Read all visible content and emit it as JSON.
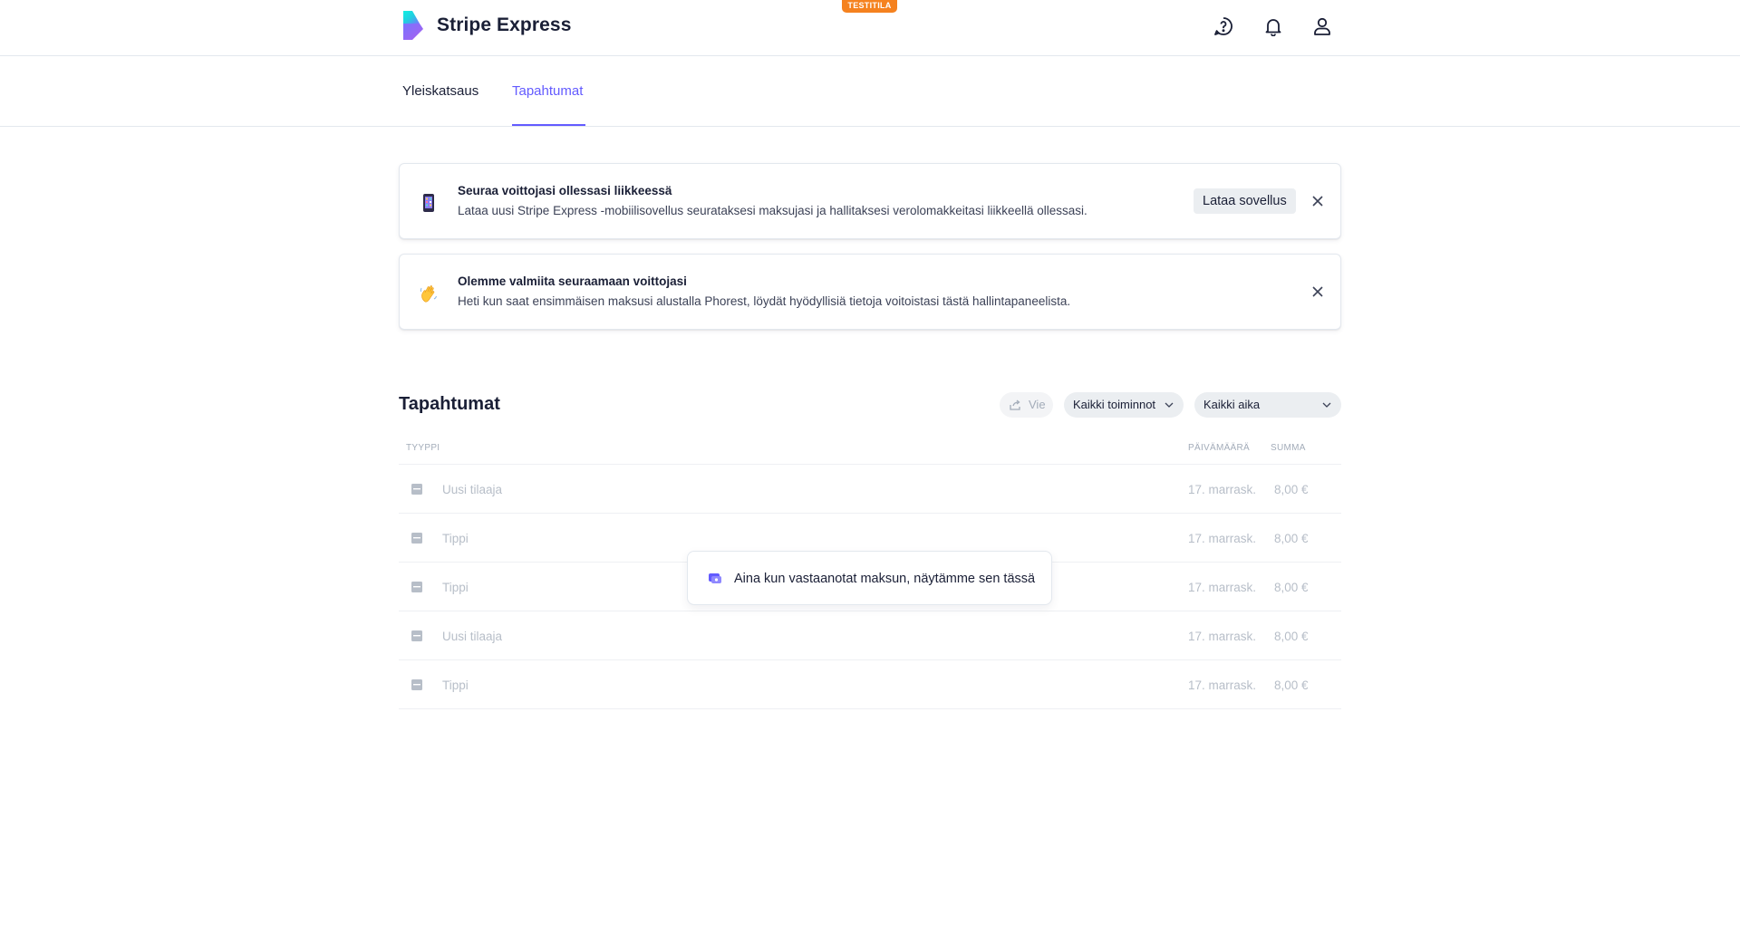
{
  "header": {
    "brand": "Stripe Express",
    "test_badge": "TESTITILA",
    "icons": [
      "help-icon",
      "bell-icon",
      "user-icon"
    ]
  },
  "tabs": [
    {
      "label": "Yleiskatsaus",
      "active": false
    },
    {
      "label": "Tapahtumat",
      "active": true
    }
  ],
  "banners": [
    {
      "icon": "phone-icon",
      "title": "Seuraa voittojasi ollessasi liikkeessä",
      "text": "Lataa uusi Stripe Express -mobiilisovellus seurataksesi maksujasi ja hallitaksesi verolomakkeitasi liikkeellä ollessasi.",
      "button": "Lataa sovellus"
    },
    {
      "icon": "waving-hand-icon",
      "title": "Olemme valmiita seuraamaan voittojasi",
      "text": "Heti kun saat ensimmäisen maksusi alustalla Phorest, löydät hyödyllisiä tietoja voitoistasi tästä hallintapaneelista."
    }
  ],
  "events": {
    "title": "Tapahtumat",
    "export_label": "Vie",
    "actions_filter": "Kaikki toiminnot",
    "time_filter": "Kaikki aika",
    "columns": {
      "type": "TYYPPI",
      "date": "PÄIVÄMÄÄRÄ",
      "amount": "SUMMA"
    },
    "rows": [
      {
        "type": "Uusi tilaaja",
        "date": "17. marrask.",
        "amount": "8,00 €"
      },
      {
        "type": "Tippi",
        "date": "17. marrask.",
        "amount": "8,00 €"
      },
      {
        "type": "Tippi",
        "date": "17. marrask.",
        "amount": "8,00 €"
      },
      {
        "type": "Uusi tilaaja",
        "date": "17. marrask.",
        "amount": "8,00 €"
      },
      {
        "type": "Tippi",
        "date": "17. marrask.",
        "amount": "8,00 €"
      }
    ],
    "empty_message": "Aina kun vastaanotat maksun, näytämme sen tässä"
  },
  "colors": {
    "accent": "#635bff",
    "badge": "#f5821f",
    "text": "#1a1f36",
    "muted": "#b7bec8"
  }
}
